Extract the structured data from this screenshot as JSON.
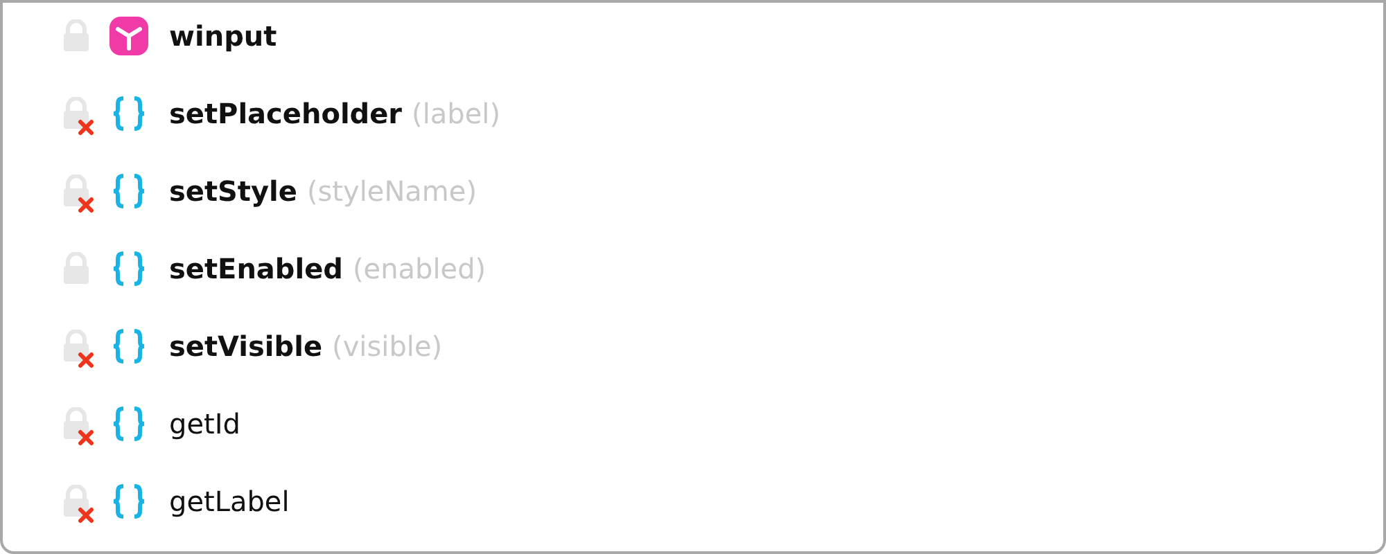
{
  "items": [
    {
      "kind": "module",
      "name": "winput",
      "bold": true,
      "error": false
    },
    {
      "kind": "function",
      "name": "setPlaceholder",
      "params": "(label)",
      "bold": true,
      "error": true
    },
    {
      "kind": "function",
      "name": "setStyle",
      "params": "(styleName)",
      "bold": true,
      "error": true
    },
    {
      "kind": "function",
      "name": "setEnabled",
      "params": "(enabled)",
      "bold": true,
      "error": false
    },
    {
      "kind": "function",
      "name": "setVisible",
      "params": "(visible)",
      "bold": true,
      "error": true
    },
    {
      "kind": "function",
      "name": "getId",
      "bold": false,
      "error": true
    },
    {
      "kind": "function",
      "name": "getLabel",
      "bold": false,
      "error": true
    }
  ]
}
